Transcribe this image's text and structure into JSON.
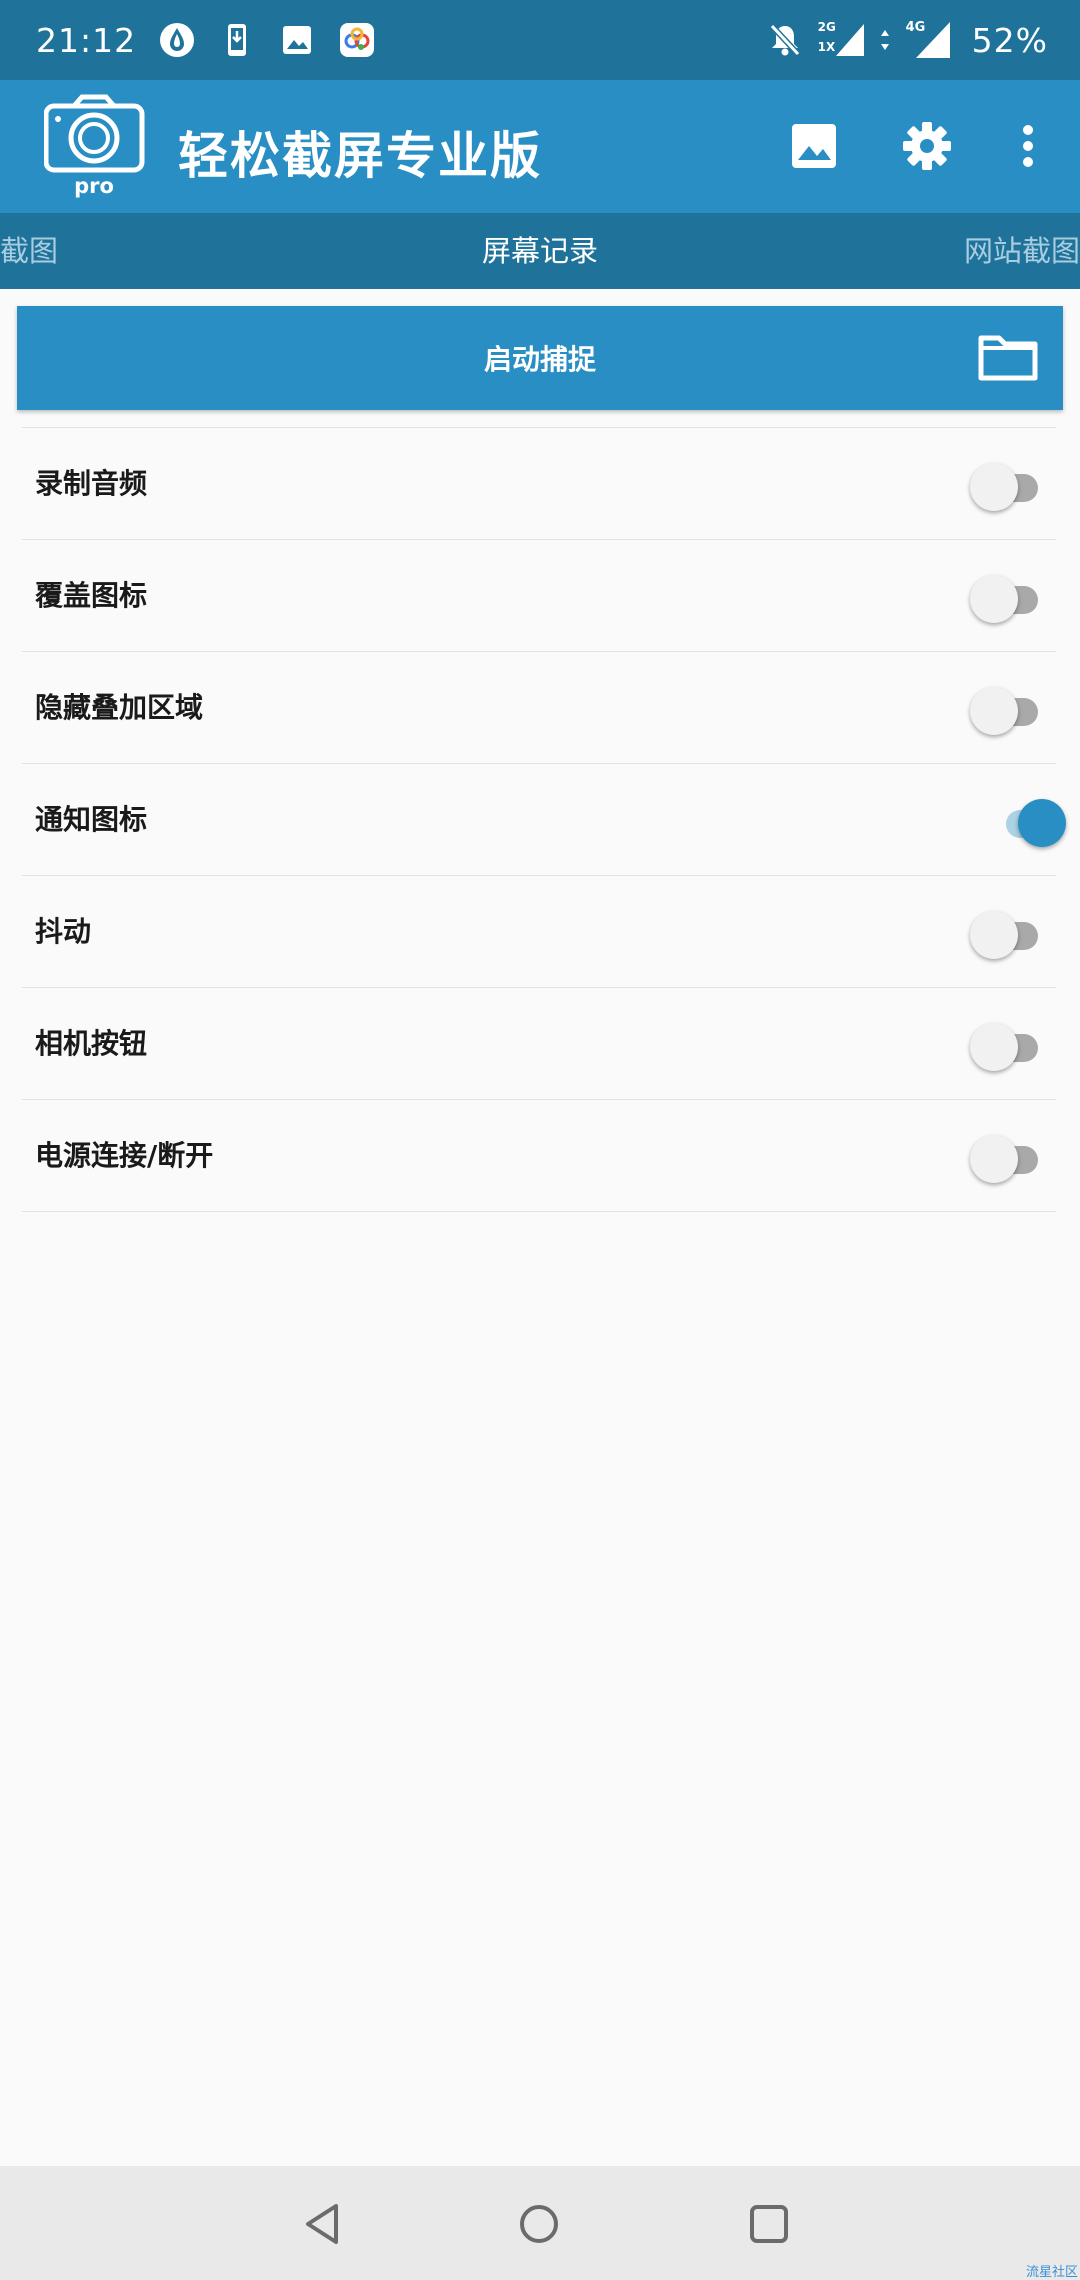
{
  "status_bar": {
    "time": "21:12",
    "network_sim1": "2G",
    "network_sim1_sub": "1X",
    "network_sim2": "4G",
    "battery": "52%",
    "icons": [
      "app-drop-icon",
      "download-phone-icon",
      "image-icon",
      "colorful-app-icon",
      "bell-off-icon",
      "signal-icon",
      "data-arrows-icon",
      "signal-icon"
    ]
  },
  "app_bar": {
    "logo_text": "pro",
    "title": "轻松截屏专业版",
    "actions": [
      "gallery-icon",
      "settings-icon",
      "more-vert-icon"
    ]
  },
  "tabs": {
    "left": "截图",
    "active": "屏幕记录",
    "right": "网站截图"
  },
  "capture": {
    "label": "启动捕捉",
    "icon": "folder-icon"
  },
  "settings": [
    {
      "label": "录制音频",
      "on": false
    },
    {
      "label": "覆盖图标",
      "on": false
    },
    {
      "label": "隐藏叠加区域",
      "on": false
    },
    {
      "label": "通知图标",
      "on": true
    },
    {
      "label": "抖动",
      "on": false
    },
    {
      "label": "相机按钮",
      "on": false
    },
    {
      "label": "电源连接/断开",
      "on": false
    }
  ],
  "nav": {
    "buttons": [
      "back-icon",
      "home-icon",
      "recents-icon"
    ],
    "watermark": "流星社区"
  },
  "colors": {
    "status_bar": "#1f739a",
    "primary": "#298ec3",
    "switch_on_track": "#abd2e5",
    "switch_off_track": "#a9a9a9"
  }
}
